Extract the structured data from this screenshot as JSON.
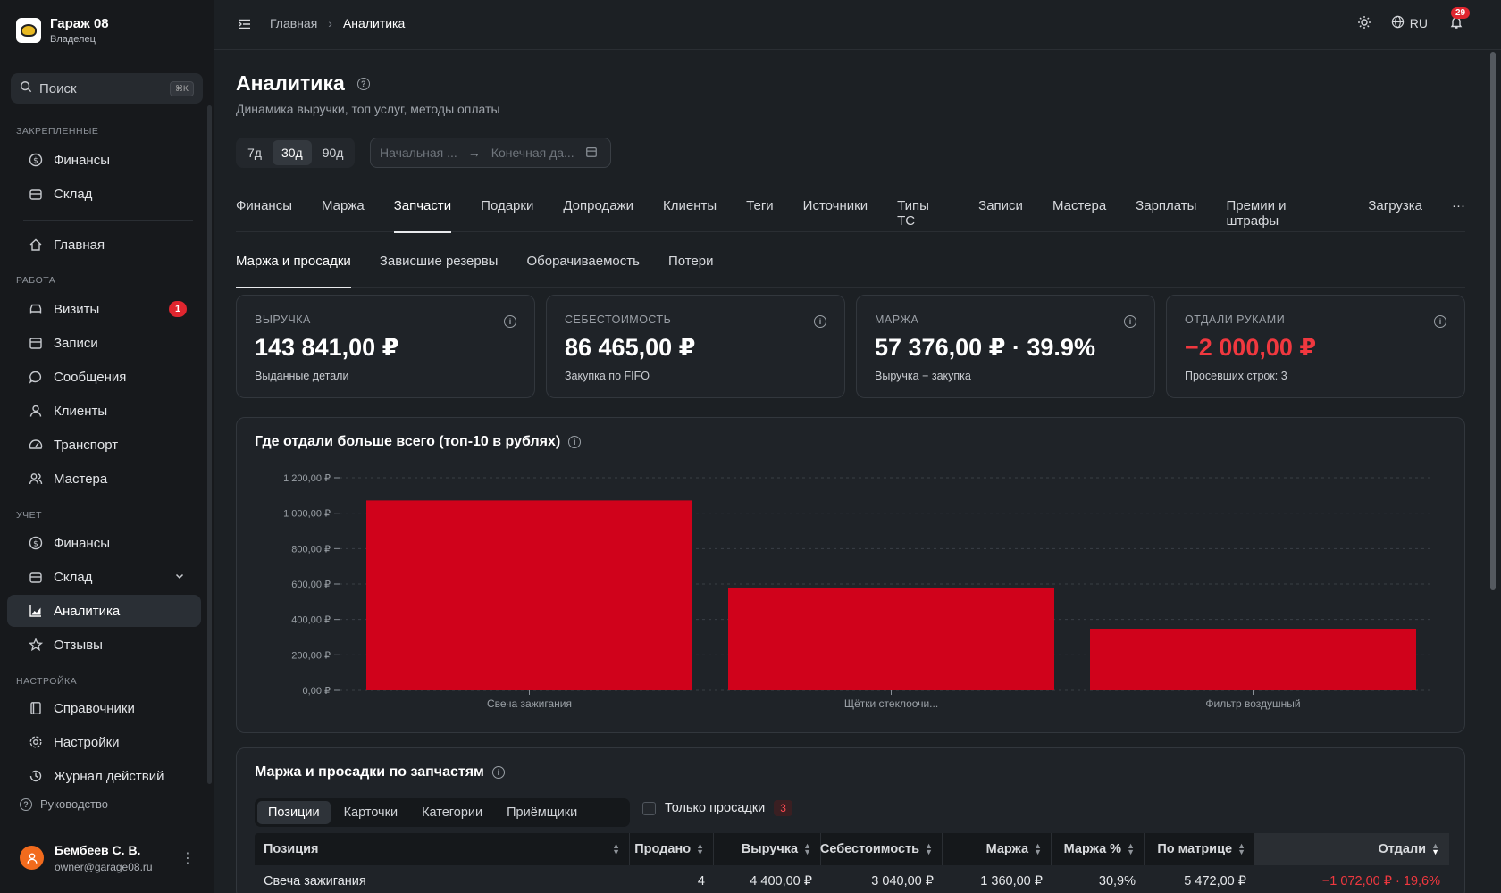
{
  "brand": {
    "name": "Гараж 08",
    "role": "Владелец"
  },
  "search": {
    "label": "Поиск",
    "shortcut": "⌘K"
  },
  "sidebar": {
    "sections": {
      "pinned": "Закрепленные",
      "work": "Работа",
      "accounting": "Учет",
      "settings": "Настройка"
    },
    "pinned": [
      {
        "label": "Финансы",
        "icon": "dollar-icon"
      },
      {
        "label": "Склад",
        "icon": "box-icon"
      }
    ],
    "home": {
      "label": "Главная",
      "icon": "home-icon"
    },
    "work": [
      {
        "label": "Визиты",
        "icon": "car-icon",
        "badge": "1"
      },
      {
        "label": "Записи",
        "icon": "calendar-icon"
      },
      {
        "label": "Сообщения",
        "icon": "message-icon"
      },
      {
        "label": "Клиенты",
        "icon": "user-icon"
      },
      {
        "label": "Транспорт",
        "icon": "gauge-icon"
      },
      {
        "label": "Мастера",
        "icon": "users-icon"
      }
    ],
    "accounting": [
      {
        "label": "Финансы",
        "icon": "dollar-icon"
      },
      {
        "label": "Склад",
        "icon": "box-icon"
      },
      {
        "label": "Аналитика",
        "icon": "chart-icon",
        "active": true
      },
      {
        "label": "Отзывы",
        "icon": "star-icon"
      }
    ],
    "settings": [
      {
        "label": "Справочники",
        "icon": "book-icon"
      },
      {
        "label": "Настройки",
        "icon": "gear-icon"
      },
      {
        "label": "Журнал действий",
        "icon": "history-icon"
      }
    ],
    "guide": "Руководство"
  },
  "user": {
    "name": "Бембеев С. В.",
    "email": "owner@garage08.ru"
  },
  "topbar": {
    "breadcrumb_home": "Главная",
    "breadcrumb_current": "Аналитика",
    "lang": "RU",
    "notifications": "29"
  },
  "page": {
    "title": "Аналитика",
    "subtitle": "Динамика выручки, топ услуг, методы оплаты"
  },
  "range": {
    "options": [
      "7д",
      "30д",
      "90д"
    ],
    "selected": "30д",
    "start_placeholder": "Начальная ...",
    "end_placeholder": "Конечная да..."
  },
  "tabs": [
    "Финансы",
    "Маржа",
    "Запчасти",
    "Подарки",
    "Допродажи",
    "Клиенты",
    "Теги",
    "Источники",
    "Типы ТС",
    "Записи",
    "Мастера",
    "Зарплаты",
    "Премии и штрафы",
    "Загрузка",
    "···"
  ],
  "active_tab": "Запчасти",
  "subtabs": [
    "Маржа и просадки",
    "Зависшие резервы",
    "Оборачиваемость",
    "Потери"
  ],
  "active_subtab": "Маржа и просадки",
  "kpis": [
    {
      "label": "Выручка",
      "value": "143 841,00 ₽",
      "sub": "Выданные детали",
      "negative": false
    },
    {
      "label": "Себестоимость",
      "value": "86 465,00 ₽",
      "sub": "Закупка по FIFO",
      "negative": false
    },
    {
      "label": "Маржа",
      "value": "57 376,00 ₽ · 39.9%",
      "sub": "Выручка − закупка",
      "negative": false
    },
    {
      "label": "Отдали руками",
      "value": "−2 000,00 ₽",
      "sub": "Просевших строк: 3",
      "negative": true
    }
  ],
  "chart_card": {
    "title": "Где отдали больше всего (топ-10 в рублях)"
  },
  "chart_data": {
    "type": "bar",
    "title": "Где отдали больше всего (топ-10 в рублях)",
    "categories": [
      "Свеча зажигания",
      "Щётки стеклоочи...",
      "Фильтр воздушный"
    ],
    "values": [
      1072,
      580,
      348
    ],
    "ylim": [
      0,
      1200
    ],
    "yticks": [
      "0,00 ₽",
      "200,00 ₽",
      "400,00 ₽",
      "600,00 ₽",
      "800,00 ₽",
      "1 000,00 ₽",
      "1 200,00 ₽"
    ],
    "ytick_values": [
      0,
      200,
      400,
      600,
      800,
      1000,
      1200
    ],
    "grid": true,
    "color": "#d0021b"
  },
  "table_card": {
    "title": "Маржа и просадки по запчастям",
    "segments": [
      "Позиции",
      "Карточки",
      "Категории",
      "Приёмщики"
    ],
    "active_segment": "Позиции",
    "only_drops_label": "Только просадки",
    "only_drops_count": "3",
    "columns": [
      "Позиция",
      "Продано",
      "Выручка",
      "Себестоимость",
      "Маржа",
      "Маржа %",
      "По матрице",
      "Отдали"
    ],
    "rows": [
      [
        "Свеча зажигания",
        "4",
        "4 400,00 ₽",
        "3 040,00 ₽",
        "1 360,00 ₽",
        "30,9%",
        "5 472,00 ₽",
        "−1 072,00 ₽ · 19,6%"
      ]
    ]
  },
  "colors": {
    "accent_red": "#d0021b",
    "negative": "#f0383f",
    "badge": "#e0262f",
    "avatar": "#f26b1d"
  }
}
